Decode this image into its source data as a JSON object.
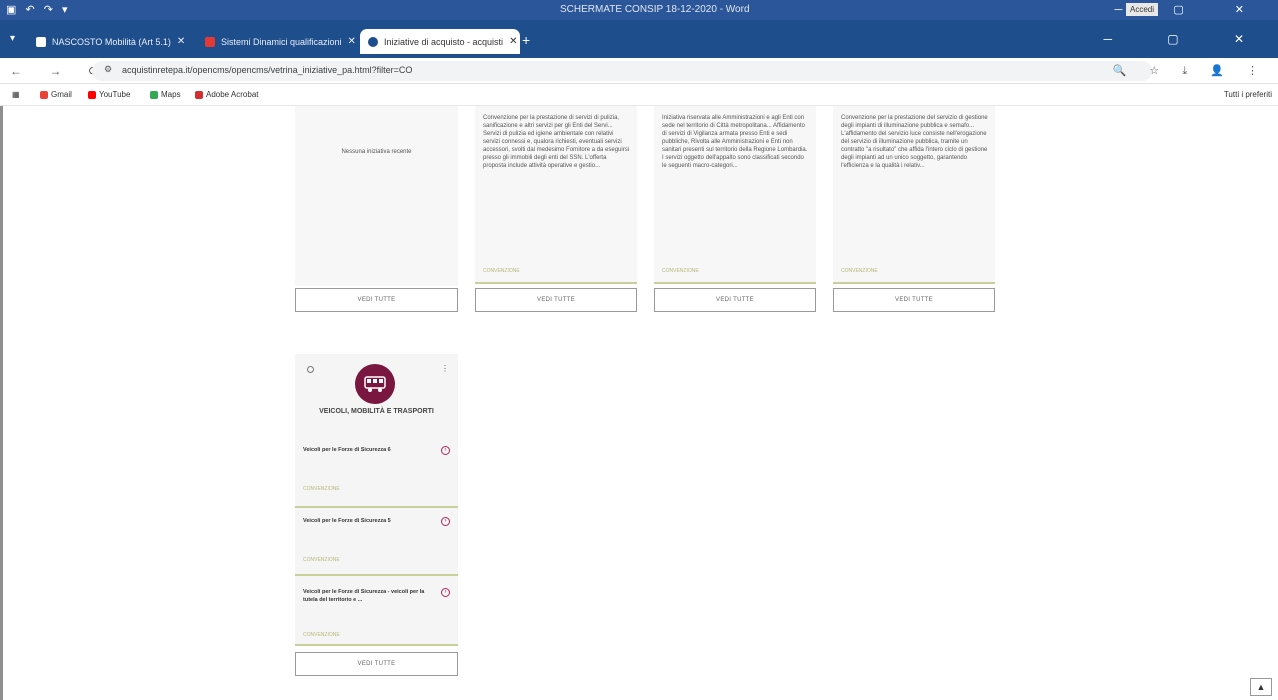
{
  "word": {
    "title": "SCHERMATE CONSIP 18-12-2020 - Word",
    "signin": "Accedi"
  },
  "tabs": [
    {
      "label": "NASCOSTO Mobilità (Art 5.1)",
      "icon_color": "#ffffff"
    },
    {
      "label": "Sistemi Dinamici qualificazioni",
      "icon_color": "#e53935"
    },
    {
      "label": "Iniziative di acquisto - acquisti",
      "icon_color": "#1f4e8c"
    }
  ],
  "address": {
    "url": "acquistinretepa.it/opencms/opencms/vetrina_iniziative_pa.html?filter=CO"
  },
  "bookmarks": [
    {
      "label": "Gmail",
      "color": "#ea4335"
    },
    {
      "label": "YouTube",
      "color": "#ff0000"
    },
    {
      "label": "Maps",
      "color": "#34a853"
    },
    {
      "label": "Adobe Acrobat",
      "color": "#d32f2f"
    }
  ],
  "bookmarks_all": "Tutti i preferiti",
  "cards": [
    {
      "text": "Nessuna iniziativa recente",
      "link": "",
      "button": "VEDI TUTTE"
    },
    {
      "text": "Convenzione per la prestazione di servizi di pulizia, sanificazione e altri servizi per gli Enti del Servi... Servizi di pulizia ed igiene ambientale con relativi servizi connessi e, qualora richiesti, eventuali servizi accessori, svolti dal medesimo Fornitore a da eseguirsi presso gli immobili degli enti del SSN. L'offerta proposta include attività operative e gestio...",
      "link": "CONVENZIONE",
      "button": "VEDI TUTTE"
    },
    {
      "text": "Iniziativa riservata alle Amministrazioni e agli Enti con sede nel territorio di Città metropolitana... Affidamento di servizi di Vigilanza armata presso Enti e sedi pubbliche, Rivolta alle Amministrazioni e Enti non sanitari presenti sul territorio della Regione Lombardia. I servizi oggetto dell'appalto sono classificati secondo le seguenti macro-categori...",
      "link": "CONVENZIONE",
      "button": "VEDI TUTTE"
    },
    {
      "text": "Convenzione per la prestazione del servizio di gestione degli impianti di illuminazione pubblica e semafo... L'affidamento del servizio luce consiste nell'erogazione del servizio di illuminazione pubblica, tramite un contratto \"a risultato\" che affida l'intero ciclo di gestione degli impianti ad un unico soggetto, garantendo l'efficienza e la qualità i relativ...",
      "link": "CONVENZIONE",
      "button": "VEDI TUTTE"
    }
  ],
  "category": {
    "title": "VEICOLI, MOBILITÀ E TRASPORTI",
    "items": [
      {
        "title": "Veicoli per le Forze di Sicurezza 6",
        "link": "CONVENZIONE"
      },
      {
        "title": "Veicoli per le Forze di Sicurezza 5",
        "link": "CONVENZIONE"
      },
      {
        "title": "Veicoli per le Forze di Sicurezza - veicoli per la tutela del territorio e ...",
        "link": "CONVENZIONE"
      }
    ],
    "button": "VEDI TUTTE"
  }
}
